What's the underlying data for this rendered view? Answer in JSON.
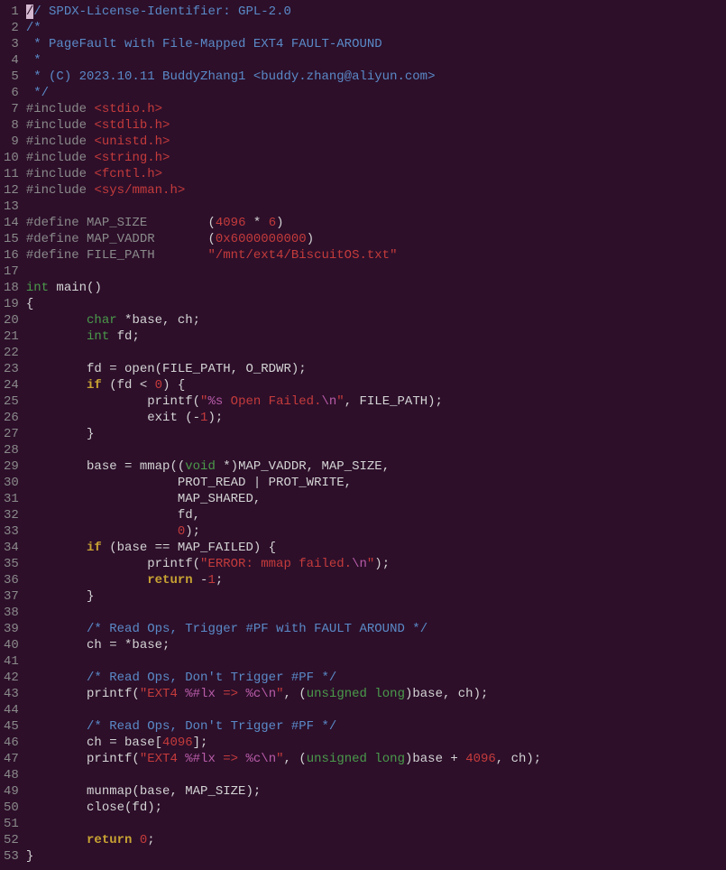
{
  "lines": [
    {
      "n": 1,
      "html": "<span class='cursor'>/</span><span class='c-comment'>/ SPDX-License-Identifier: GPL-2.0</span>"
    },
    {
      "n": 2,
      "html": "<span class='c-comment'>/*</span>"
    },
    {
      "n": 3,
      "html": "<span class='c-comment'> * PageFault with File-Mapped EXT4 FAULT-AROUND</span>"
    },
    {
      "n": 4,
      "html": "<span class='c-comment'> *</span>"
    },
    {
      "n": 5,
      "html": "<span class='c-comment'> * (C) 2023.10.11 BuddyZhang1 &lt;buddy.zhang@aliyun.com&gt;</span>"
    },
    {
      "n": 6,
      "html": "<span class='c-comment'> */</span>"
    },
    {
      "n": 7,
      "html": "<span class='c-preproc'>#include </span><span class='c-string'>&lt;stdio.h&gt;</span>"
    },
    {
      "n": 8,
      "html": "<span class='c-preproc'>#include </span><span class='c-string'>&lt;stdlib.h&gt;</span>"
    },
    {
      "n": 9,
      "html": "<span class='c-preproc'>#include </span><span class='c-string'>&lt;unistd.h&gt;</span>"
    },
    {
      "n": 10,
      "html": "<span class='c-preproc'>#include </span><span class='c-string'>&lt;string.h&gt;</span>"
    },
    {
      "n": 11,
      "html": "<span class='c-preproc'>#include </span><span class='c-string'>&lt;fcntl.h&gt;</span>"
    },
    {
      "n": 12,
      "html": "<span class='c-preproc'>#include </span><span class='c-string'>&lt;sys/mman.h&gt;</span>"
    },
    {
      "n": 13,
      "html": ""
    },
    {
      "n": 14,
      "html": "<span class='c-preproc'>#define MAP_SIZE        </span>(<span class='c-number'>4096</span> * <span class='c-number'>6</span>)"
    },
    {
      "n": 15,
      "html": "<span class='c-preproc'>#define MAP_VADDR       </span>(<span class='c-number'>0x6000000000</span>)"
    },
    {
      "n": 16,
      "html": "<span class='c-preproc'>#define FILE_PATH       </span><span class='c-string'>\"/mnt/ext4/BiscuitOS.txt\"</span>"
    },
    {
      "n": 17,
      "html": ""
    },
    {
      "n": 18,
      "html": "<span class='c-type'>int</span> main()"
    },
    {
      "n": 19,
      "html": "{"
    },
    {
      "n": 20,
      "html": "        <span class='c-type'>char</span> *base, ch;"
    },
    {
      "n": 21,
      "html": "        <span class='c-type'>int</span> fd;"
    },
    {
      "n": 22,
      "html": ""
    },
    {
      "n": 23,
      "html": "        fd = open(FILE_PATH, O_RDWR);"
    },
    {
      "n": 24,
      "html": "        <span class='c-keyword'>if</span> (fd &lt; <span class='c-number'>0</span>) {"
    },
    {
      "n": 25,
      "html": "                printf(<span class='c-string'>\"</span><span class='c-fmt'>%s</span><span class='c-string'> Open Failed.</span><span class='c-esc'>\\n</span><span class='c-string'>\"</span>, FILE_PATH);"
    },
    {
      "n": 26,
      "html": "                exit (-<span class='c-number'>1</span>);"
    },
    {
      "n": 27,
      "html": "        }"
    },
    {
      "n": 28,
      "html": ""
    },
    {
      "n": 29,
      "html": "        base = mmap((<span class='c-type'>void</span> *)MAP_VADDR, MAP_SIZE,"
    },
    {
      "n": 30,
      "html": "                    PROT_READ | PROT_WRITE,"
    },
    {
      "n": 31,
      "html": "                    MAP_SHARED,"
    },
    {
      "n": 32,
      "html": "                    fd,"
    },
    {
      "n": 33,
      "html": "                    <span class='c-number'>0</span>);"
    },
    {
      "n": 34,
      "html": "        <span class='c-keyword'>if</span> (base == MAP_FAILED) {"
    },
    {
      "n": 35,
      "html": "                printf(<span class='c-string'>\"ERROR: mmap failed.</span><span class='c-esc'>\\n</span><span class='c-string'>\"</span>);"
    },
    {
      "n": 36,
      "html": "                <span class='c-keyword'>return</span> -<span class='c-number'>1</span>;"
    },
    {
      "n": 37,
      "html": "        }"
    },
    {
      "n": 38,
      "html": ""
    },
    {
      "n": 39,
      "html": "        <span class='c-comment'>/* Read Ops, Trigger #PF with FAULT AROUND */</span>"
    },
    {
      "n": 40,
      "html": "        ch = *base;"
    },
    {
      "n": 41,
      "html": ""
    },
    {
      "n": 42,
      "html": "        <span class='c-comment'>/* Read Ops, Don't Trigger #PF */</span>"
    },
    {
      "n": 43,
      "html": "        printf(<span class='c-string'>\"EXT4 </span><span class='c-fmt'>%#lx</span><span class='c-string'> =&gt; </span><span class='c-fmt'>%c</span><span class='c-esc'>\\n</span><span class='c-string'>\"</span>, (<span class='c-type'>unsigned</span> <span class='c-type'>long</span>)base, ch);"
    },
    {
      "n": 44,
      "html": ""
    },
    {
      "n": 45,
      "html": "        <span class='c-comment'>/* Read Ops, Don't Trigger #PF */</span>"
    },
    {
      "n": 46,
      "html": "        ch = base[<span class='c-number'>4096</span>];"
    },
    {
      "n": 47,
      "html": "        printf(<span class='c-string'>\"EXT4 </span><span class='c-fmt'>%#lx</span><span class='c-string'> =&gt; </span><span class='c-fmt'>%c</span><span class='c-esc'>\\n</span><span class='c-string'>\"</span>, (<span class='c-type'>unsigned</span> <span class='c-type'>long</span>)base + <span class='c-number'>4096</span>, ch);"
    },
    {
      "n": 48,
      "html": ""
    },
    {
      "n": 49,
      "html": "        munmap(base, MAP_SIZE);"
    },
    {
      "n": 50,
      "html": "        close(fd);"
    },
    {
      "n": 51,
      "html": ""
    },
    {
      "n": 52,
      "html": "        <span class='c-keyword'>return</span> <span class='c-number'>0</span>;"
    },
    {
      "n": 53,
      "html": "}"
    }
  ]
}
